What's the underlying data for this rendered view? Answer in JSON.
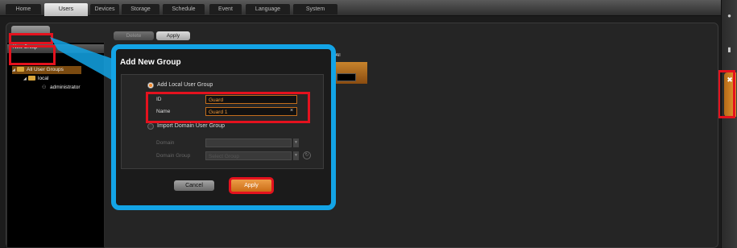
{
  "nav": {
    "tabs": [
      {
        "label": "Home"
      },
      {
        "label": "Users"
      },
      {
        "label": "Devices"
      },
      {
        "label": "Storage"
      },
      {
        "label": "Schedule"
      },
      {
        "label": "Event"
      },
      {
        "label": "Language"
      },
      {
        "label": "System"
      }
    ],
    "active_tab": "Users"
  },
  "toolbar": {
    "delete_label": "Delete",
    "apply_label": "Apply"
  },
  "left_panel": {
    "new_group_label": "New Group",
    "tree": [
      {
        "label": "All User Groups",
        "selected": true
      },
      {
        "label": "local"
      },
      {
        "label": "administrator"
      }
    ]
  },
  "right_panel": {
    "select_all_label": "ct All"
  },
  "dialog": {
    "title": "Add New Group",
    "local_option_label": "Add Local User Group",
    "id_label": "ID",
    "id_value": "Guard",
    "name_label": "Name",
    "name_value": "Guard 1",
    "domain_option_label": "Import Domain User Group",
    "domain_label": "Domain",
    "domain_group_label": "Domain Group",
    "domain_group_placeholder": "Select Group",
    "cancel_label": "Cancel",
    "apply_label": "Apply",
    "selected_option": "local"
  },
  "colors": {
    "accent": "#13a4e6",
    "highlight": "#e4121e",
    "orange": "#e8962e"
  },
  "icons": {
    "clear": "x-icon",
    "refresh": "refresh-icon",
    "tools": "tools-icon"
  }
}
